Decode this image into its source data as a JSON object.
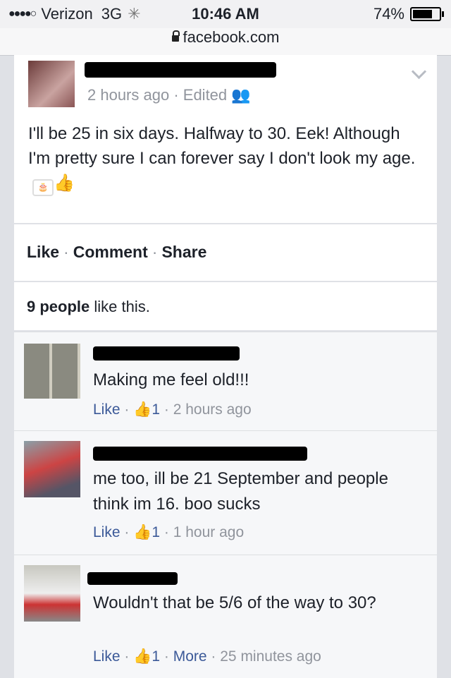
{
  "status_bar": {
    "carrier": "Verizon",
    "network": "3G",
    "time": "10:46 AM",
    "battery": "74%",
    "battery_level": 0.74
  },
  "browser": {
    "url": "facebook.com"
  },
  "post": {
    "meta_time": "2 hours ago",
    "meta_edited": "· Edited",
    "text": "I'll be 25 in six days. Halfway to 30. Eek! Although I'm pretty sure I can forever say I don't look my age.",
    "icons": [
      "birthday-cake-icon",
      "like-icon"
    ]
  },
  "actions": {
    "like": "Like",
    "comment": "Comment",
    "share": "Share",
    "sep": "·"
  },
  "likes_summary": {
    "count": "9 people",
    "text": "like this."
  },
  "comments": [
    {
      "text": "Making me feel old!!!",
      "like": "Like",
      "likes": "1",
      "time": "2 hours ago"
    },
    {
      "text": "me too, ill be 21 September and people think im 16. boo sucks",
      "like": "Like",
      "likes": "1",
      "time": "1 hour ago"
    },
    {
      "text": "Wouldn't that be 5/6 of the way to 30?",
      "like": "Like",
      "likes": "1",
      "more": "More",
      "time": "25 minutes ago"
    }
  ],
  "colors": {
    "link": "#3b5998",
    "muted": "#90949c",
    "background": "#dfe1e6"
  }
}
